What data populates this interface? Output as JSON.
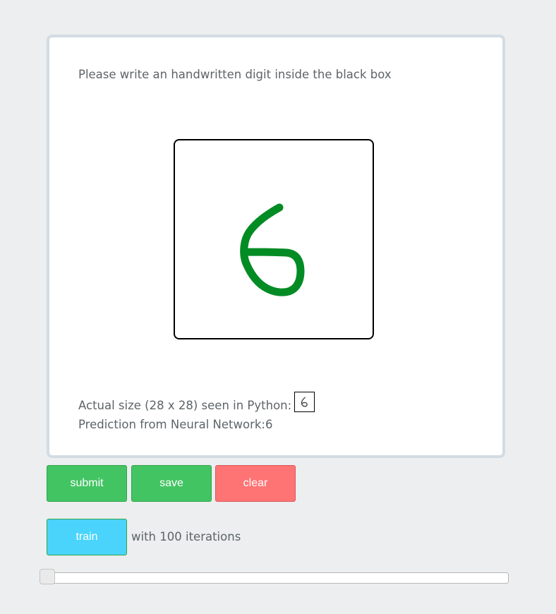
{
  "instruction": "Please write an handwritten digit inside the black box",
  "size_label": "Actual size (28 x 28) seen in Python:",
  "prediction_label": "Prediction from Neural Network:",
  "prediction_value": "6",
  "buttons": {
    "submit": "submit",
    "save": "save",
    "clear": "clear",
    "train": "train"
  },
  "iterations_text": "with 100 iterations",
  "slider": {
    "value_fraction": 0.0
  },
  "colors": {
    "stroke": "#038b24",
    "submit": "#43c463",
    "clear": "#fe7374",
    "train": "#4ad4fb"
  },
  "icons": {
    "drawing": "handwritten-digit-6"
  }
}
